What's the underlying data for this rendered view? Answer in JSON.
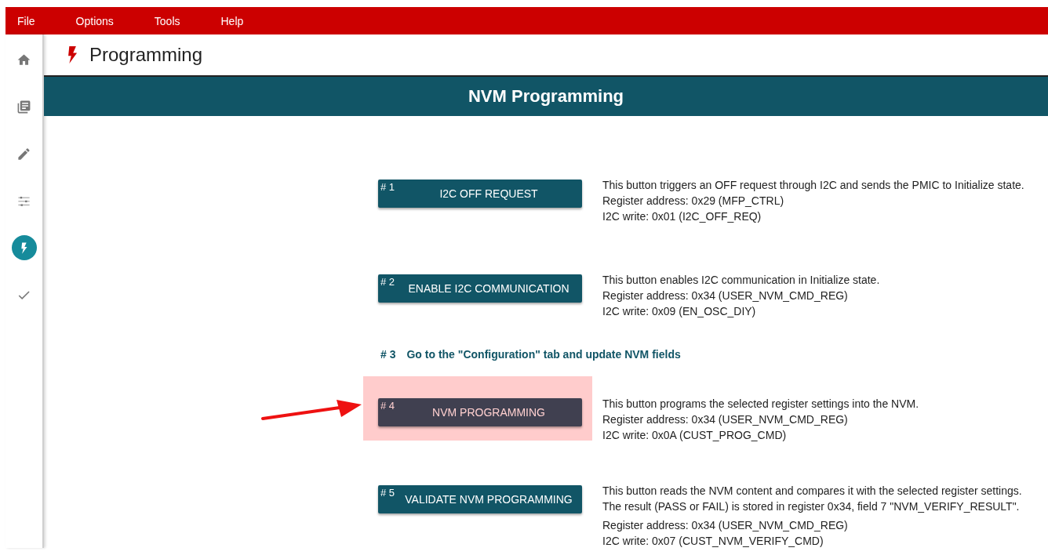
{
  "menu": [
    "File",
    "Options",
    "Tools",
    "Help"
  ],
  "sidebar": {
    "items": [
      {
        "kind": "home",
        "selected": false
      },
      {
        "kind": "book",
        "selected": false
      },
      {
        "kind": "pencil",
        "selected": false
      },
      {
        "kind": "sliders",
        "selected": false
      },
      {
        "kind": "bolt",
        "selected": true
      },
      {
        "kind": "check",
        "selected": false
      }
    ]
  },
  "page": {
    "title": "Programming",
    "banner": "NVM Programming"
  },
  "steps": [
    {
      "kind": "button",
      "number": "# 1",
      "label": "I2C OFF REQUEST",
      "highlighted": false,
      "description": [
        "This button triggers an OFF request through I2C and sends the PMIC to Initialize state."
      ],
      "register": "Register address: 0x29 (MFP_CTRL)",
      "write": "I2C write: 0x01 (I2C_OFF_REQ)"
    },
    {
      "kind": "button",
      "number": "# 2",
      "label": "ENABLE I2C COMMUNICATION",
      "highlighted": false,
      "description": [
        "This button enables I2C communication in Initialize state."
      ],
      "register": "Register address: 0x34 (USER_NVM_CMD_REG)",
      "write": "I2C write: 0x09 (EN_OSC_DIY)"
    },
    {
      "kind": "instruction",
      "number": "# 3",
      "label": "Go to the \"Configuration\" tab and update NVM fields"
    },
    {
      "kind": "button",
      "number": "# 4",
      "label": "NVM PROGRAMMING",
      "highlighted": true,
      "description": [
        "This button programs the selected register settings into the NVM."
      ],
      "register": "Register address: 0x34 (USER_NVM_CMD_REG)",
      "write": "I2C write: 0x0A (CUST_PROG_CMD)"
    },
    {
      "kind": "button",
      "number": "# 5",
      "label": "VALIDATE NVM PROGRAMMING",
      "highlighted": false,
      "description": [
        "This button reads the NVM content and compares it with the selected register settings.",
        "The result (PASS or FAIL) is stored in register 0x34, field 7 \"NVM_VERIFY_RESULT\"."
      ],
      "register": "Register address: 0x34 (USER_NVM_CMD_REG)",
      "write": "I2C write: 0x07 (CUST_NVM_VERIFY_CMD)"
    }
  ]
}
